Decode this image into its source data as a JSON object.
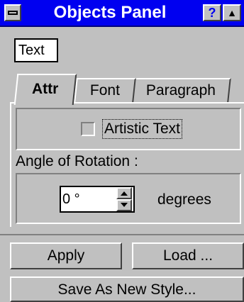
{
  "window": {
    "title": "Objects Panel",
    "help_label": "?",
    "roll_label": "▲"
  },
  "object_type": "Text",
  "tabs": [
    {
      "label": "Attr",
      "active": true
    },
    {
      "label": "Font",
      "active": false
    },
    {
      "label": "Paragraph",
      "active": false
    }
  ],
  "attr": {
    "artistic_text_label": "Artistic Text",
    "artistic_text_checked": false,
    "angle_label": "Angle of Rotation :",
    "angle_value": "0 °",
    "angle_units": "degrees"
  },
  "buttons": {
    "apply": "Apply",
    "load": "Load ...",
    "save_as": "Save As New Style..."
  },
  "colors": {
    "titlebar": "#0000f0",
    "face": "#c0c0c0"
  },
  "icons": {
    "system_menu": "system-menu-icon",
    "help": "help-icon",
    "roll_up": "roll-up-icon",
    "spin_up": "spin-up-icon",
    "spin_down": "spin-down-icon"
  }
}
